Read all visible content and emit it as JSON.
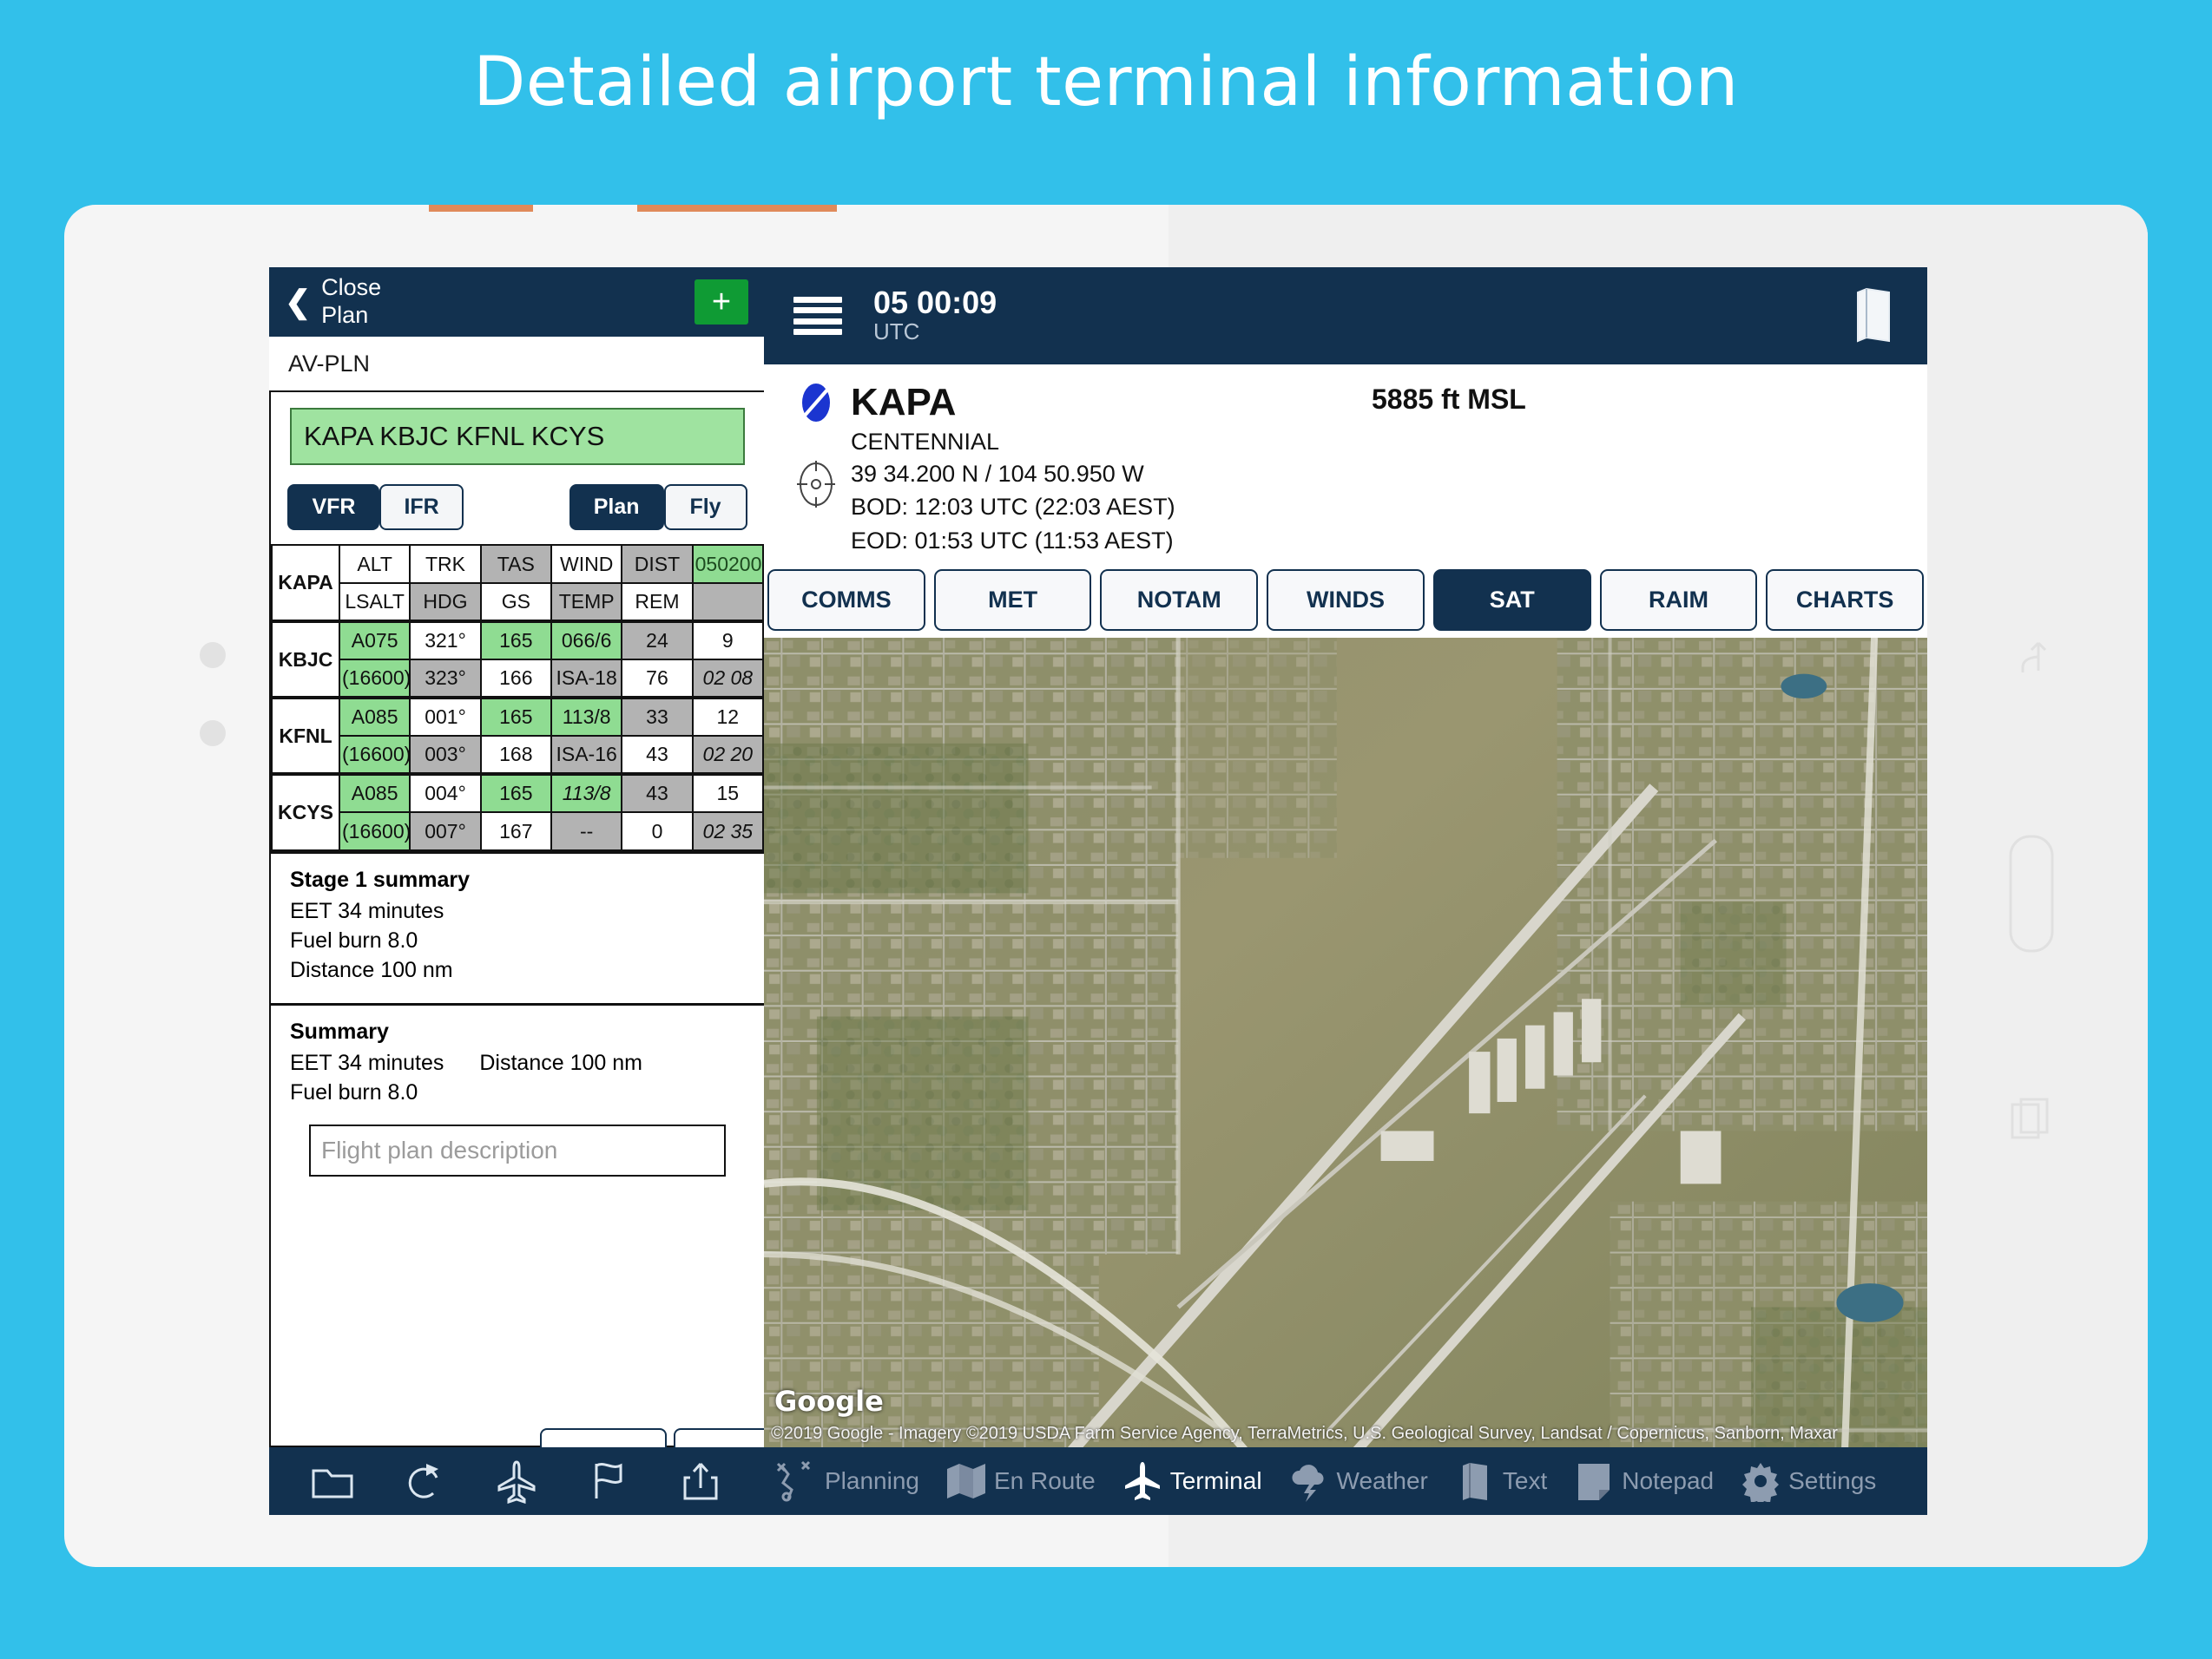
{
  "hero": {
    "title": "Detailed airport terminal information"
  },
  "left_panel": {
    "header": {
      "back_label": "Close\nPlan",
      "back_line1": "Close",
      "back_line2": "Plan",
      "add_label": "+"
    },
    "filename": "AV-PLN",
    "route": "KAPA KBJC KFNL KCYS",
    "mode_buttons": [
      {
        "label": "VFR",
        "active": true
      },
      {
        "label": "IFR",
        "active": false
      }
    ],
    "action_buttons": [
      {
        "label": "Plan",
        "active": true
      },
      {
        "label": "Fly",
        "active": false
      }
    ],
    "table": {
      "origin": "KAPA",
      "header_row1": [
        "ALT",
        "TRK",
        "TAS",
        "WIND",
        "DIST",
        "050200"
      ],
      "header_row2": [
        "LSALT",
        "HDG",
        "GS",
        "TEMP",
        "REM",
        ""
      ],
      "rows": [
        {
          "waypoint": "KBJC",
          "line1": [
            "A075",
            "321°",
            "165",
            "066/6",
            "24",
            "9"
          ],
          "line2": [
            "(16600)",
            "323°",
            "166",
            "ISA-18",
            "76",
            "02 08"
          ]
        },
        {
          "waypoint": "KFNL",
          "line1": [
            "A085",
            "001°",
            "165",
            "113/8",
            "33",
            "12"
          ],
          "line2": [
            "(16600)",
            "003°",
            "168",
            "ISA-16",
            "43",
            "02 20"
          ]
        },
        {
          "waypoint": "KCYS",
          "line1": [
            "A085",
            "004°",
            "165",
            "113/8",
            "43",
            "15"
          ],
          "line2": [
            "(16600)",
            "007°",
            "167",
            "--",
            "0",
            "02 35"
          ]
        }
      ]
    },
    "stage_summary": {
      "title": "Stage 1 summary",
      "eet": "EET 34 minutes",
      "fuel": "Fuel burn 8.0",
      "distance": "Distance 100 nm"
    },
    "summary": {
      "title": "Summary",
      "eet": "EET 34 minutes",
      "distance": "Distance 100 nm",
      "fuel": "Fuel burn 8.0"
    },
    "description_placeholder": "Flight plan description",
    "toolbar_icons": [
      "folder-icon",
      "redo-icon",
      "aircraft-icon",
      "flag-icon",
      "share-icon"
    ]
  },
  "right_panel": {
    "header": {
      "time": "05 00:09",
      "zone": "UTC",
      "menu_icon": "hamburger-icon",
      "book_icon": "book-icon"
    },
    "airport": {
      "code": "KAPA",
      "name": "CENTENNIAL",
      "elevation": "5885 ft MSL",
      "coordinates": "39 34.200 N / 104 50.950 W",
      "bod": "BOD: 12:03 UTC (22:03 AEST)",
      "eod": "EOD: 01:53 UTC (11:53 AEST)"
    },
    "tabs": [
      {
        "label": "COMMS",
        "active": false
      },
      {
        "label": "MET",
        "active": false
      },
      {
        "label": "NOTAM",
        "active": false
      },
      {
        "label": "WINDS",
        "active": false
      },
      {
        "label": "SAT",
        "active": true
      },
      {
        "label": "RAIM",
        "active": false
      },
      {
        "label": "CHARTS",
        "active": false
      }
    ],
    "map": {
      "brand": "Google",
      "attribution": "©2019 Google - Imagery ©2019 USDA Farm Service Agency, TerraMetrics, U.S. Geological Survey, Landsat / Copernicus, Sanborn, Maxar"
    },
    "nav": [
      {
        "label": "Planning",
        "icon": "planning-icon",
        "active": false
      },
      {
        "label": "En Route",
        "icon": "map-icon",
        "active": false
      },
      {
        "label": "Terminal",
        "icon": "aircraft-icon",
        "active": true
      },
      {
        "label": "Weather",
        "icon": "cloud-lightning-icon",
        "active": false
      },
      {
        "label": "Text",
        "icon": "book-icon",
        "active": false
      },
      {
        "label": "Notepad",
        "icon": "notepad-icon",
        "active": false
      },
      {
        "label": "Settings",
        "icon": "gear-icon",
        "active": false
      }
    ]
  },
  "colors": {
    "brand_blue": "#32c0ea",
    "navy": "#12314f",
    "green_cell": "#8fdc92",
    "grey_cell": "#b3b3b3",
    "add_green": "#0f9b34"
  }
}
